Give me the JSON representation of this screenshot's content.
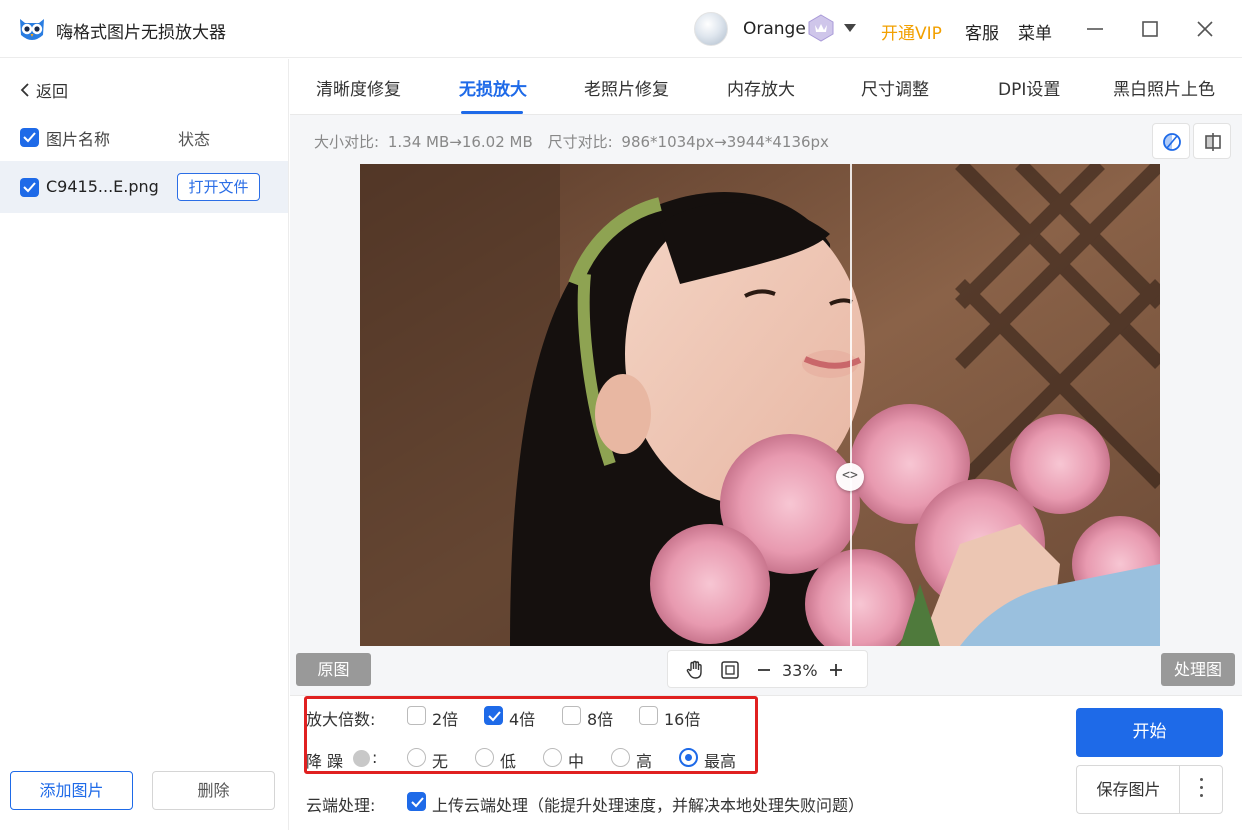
{
  "window": {
    "title": "嗨格式图片无损放大器"
  },
  "header": {
    "user_name": "Orange",
    "vip_link": "开通VIP",
    "service": "客服",
    "menu": "菜单"
  },
  "sidebar": {
    "back": "返回",
    "header_name": "图片名称",
    "header_status": "状态",
    "files": [
      {
        "name": "C9415...E.png",
        "action": "打开文件",
        "checked": true
      }
    ],
    "add_button": "添加图片",
    "delete_button": "删除"
  },
  "tabs": [
    {
      "label": "清晰度修复",
      "active": false
    },
    {
      "label": "无损放大",
      "active": true
    },
    {
      "label": "老照片修复",
      "active": false
    },
    {
      "label": "内存放大",
      "active": false
    },
    {
      "label": "尺寸调整",
      "active": false
    },
    {
      "label": "DPI设置",
      "active": false
    },
    {
      "label": "黑白照片上色",
      "active": false
    }
  ],
  "info": {
    "size_label": "大小对比:",
    "size_from": "1.34 MB",
    "size_to": "16.02 MB",
    "dim_label": "尺寸对比:",
    "dim_from": "986*1034px",
    "dim_to": "3944*4136px",
    "arrow": "→"
  },
  "preview": {
    "original_label": "原图",
    "processed_label": "处理图",
    "zoom": "33%",
    "split_fraction": 0.5225
  },
  "options": {
    "scale_label": "放大倍数:",
    "scale_options": [
      {
        "label": "2倍",
        "checked": false
      },
      {
        "label": "4倍",
        "checked": true
      },
      {
        "label": "8倍",
        "checked": false
      },
      {
        "label": "16倍",
        "checked": false
      }
    ],
    "denoise_label": "降 躁",
    "denoise_colon": ":",
    "denoise_options": [
      {
        "label": "无",
        "selected": false
      },
      {
        "label": "低",
        "selected": false
      },
      {
        "label": "中",
        "selected": false
      },
      {
        "label": "高",
        "selected": false
      },
      {
        "label": "最高",
        "selected": true
      }
    ],
    "cloud_label": "云端处理:",
    "cloud_option": "上传云端处理（能提升处理速度，并解决本地处理失败问题）",
    "cloud_checked": true
  },
  "actions": {
    "start": "开始",
    "save": "保存图片"
  },
  "colors": {
    "accent": "#1e6ae8",
    "vip": "#f2a000",
    "highlight": "#e02020"
  }
}
